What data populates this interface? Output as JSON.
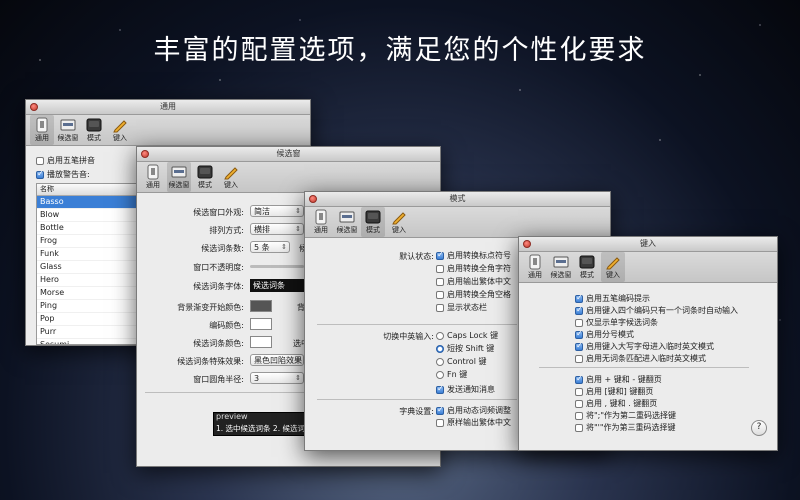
{
  "headline": "丰富的配置选项，满足您的个性化要求",
  "toolbar": {
    "general": "通用",
    "candidate": "候选窗",
    "mode": "模式",
    "keys": "键入"
  },
  "win_general": {
    "title": "通用",
    "wubi": "启用五笔拼音",
    "alert_sound": "播放警告音:",
    "list_header": "名称",
    "sounds": [
      "Basso",
      "Blow",
      "Bottle",
      "Frog",
      "Funk",
      "Glass",
      "Hero",
      "Morse",
      "Ping",
      "Pop",
      "Purr",
      "Sosumi"
    ]
  },
  "win_candidate": {
    "title": "候选窗",
    "appearance_label": "候选窗口外观:",
    "appearance_value": "简洁",
    "layout_label": "排列方式:",
    "layout_value": "横排",
    "count_label": "候选词条数:",
    "count_value": "5 条",
    "count_extra": "候",
    "opacity_label": "窗口不透明度:",
    "font_label": "候选词条字体:",
    "font_value": "候选词条",
    "bgstart_label": "背景渐变开始颜色:",
    "bgstart_extra": "背",
    "code_color_label": "编码颜色:",
    "cand_color_label": "候选词条颜色:",
    "cand_color_extra": "选中",
    "effect_label": "候选词条特殊效果:",
    "effect_value": "黑色凹陷效果",
    "radius_label": "窗口圆角半径:",
    "radius_value": "3",
    "preview_label": "preview",
    "preview_text": "1. 选中候选词条 2. 候选词条 3. 候选词条"
  },
  "win_mode": {
    "title": "模式",
    "default_label": "默认状态:",
    "defaults": [
      {
        "text": "启用转换标点符号",
        "on": true
      },
      {
        "text": "启用转换全角字符",
        "on": false
      },
      {
        "text": "启用输出繁体中文",
        "on": false
      },
      {
        "text": "启用转换全角空格",
        "on": false
      },
      {
        "text": "显示状态栏",
        "on": false
      }
    ],
    "switch_label": "切换中英输入:",
    "switch_options": [
      {
        "text": "Caps Lock 键",
        "on": false
      },
      {
        "text": "短按 Shift 键",
        "on": true
      },
      {
        "text": "Control 键",
        "on": false
      },
      {
        "text": "Fn 键",
        "on": false
      }
    ],
    "notify": "发送通知消息",
    "dict_label": "字典设置:",
    "dict_options": [
      {
        "text": "启用动态词频调整",
        "on": true
      },
      {
        "text": "原样输出繁体中文",
        "on": false
      }
    ]
  },
  "win_keys": {
    "title": "键入",
    "group1": [
      {
        "text": "启用五笔编码提示",
        "on": true
      },
      {
        "text": "启用键入四个编码只有一个词条时自动输入",
        "on": true
      },
      {
        "text": "仅显示单字候选词条",
        "on": false
      },
      {
        "text": "启用分号模式",
        "on": true
      },
      {
        "text": "启用键入大写字母进入临时英文模式",
        "on": true
      },
      {
        "text": "启用无词条匹配进入临时英文模式",
        "on": false
      }
    ],
    "group2": [
      {
        "text": "启用 + 键和 - 键翻页",
        "on": true
      },
      {
        "text": "启用 [键和] 键翻页",
        "on": false
      },
      {
        "text": "启用 , 键和 . 键翻页",
        "on": false
      },
      {
        "text": "将\";\"作为第二重码选择键",
        "on": false
      },
      {
        "text": "将\"'\"作为第三重码选择键",
        "on": false
      }
    ],
    "help": "?"
  },
  "colors": {
    "accent": "#3b7fd6",
    "selected": "#3b7fd6"
  }
}
